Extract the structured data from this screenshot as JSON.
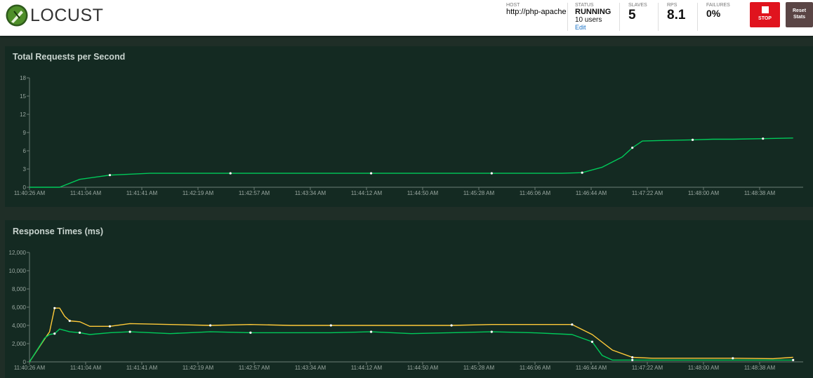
{
  "header": {
    "logo_text": "LOCUST",
    "host": {
      "label": "HOST",
      "value": "http://php-apache"
    },
    "status": {
      "label": "STATUS",
      "value": "RUNNING",
      "users": "10 users",
      "edit": "Edit"
    },
    "slaves": {
      "label": "SLAVES",
      "value": "5"
    },
    "rps": {
      "label": "RPS",
      "value": "8.1"
    },
    "failures": {
      "label": "FAILURES",
      "value": "0%"
    },
    "stop_label": "STOP",
    "reset_label_1": "Reset",
    "reset_label_2": "Stats"
  },
  "colors": {
    "green": "#00ca5a",
    "yellow": "#ffca39",
    "stop": "#e0141e"
  },
  "chart_data": [
    {
      "type": "line",
      "title": "Total Requests per Second",
      "xlabel": "",
      "ylabel": "",
      "ylim": [
        0,
        18
      ],
      "yticks": [
        "0",
        "3",
        "6",
        "9",
        "12",
        "15",
        "18"
      ],
      "xticks": [
        "11:40:26 AM",
        "11:41:04 AM",
        "11:41:41 AM",
        "11:42:19 AM",
        "11:42:57 AM",
        "11:43:34 AM",
        "11:44:12 AM",
        "11:44:50 AM",
        "11:45:28 AM",
        "11:46:06 AM",
        "11:46:44 AM",
        "11:47:22 AM",
        "11:48:00 AM",
        "11:48:38 AM"
      ],
      "grid": false,
      "series": [
        {
          "color": "#00ca5a",
          "x": [
            0,
            3,
            5,
            8,
            12,
            16,
            20,
            26,
            30,
            34,
            38,
            42,
            46,
            50,
            53,
            55,
            57,
            59,
            60,
            61,
            63,
            66,
            68,
            70,
            73,
            76
          ],
          "values": [
            0,
            0,
            1.3,
            2.0,
            2.3,
            2.3,
            2.3,
            2.3,
            2.3,
            2.3,
            2.3,
            2.3,
            2.3,
            2.3,
            2.3,
            2.4,
            3.3,
            5.0,
            6.5,
            7.6,
            7.7,
            7.8,
            7.9,
            7.9,
            8.0,
            8.1
          ]
        }
      ]
    },
    {
      "type": "line",
      "title": "Response Times (ms)",
      "xlabel": "",
      "ylabel": "",
      "ylim": [
        0,
        12000
      ],
      "yticks": [
        "0",
        "2,000",
        "4,000",
        "6,000",
        "8,000",
        "10,000",
        "12,000"
      ],
      "xticks": [
        "11:40:26 AM",
        "11:41:04 AM",
        "11:41:41 AM",
        "11:42:19 AM",
        "11:42:57 AM",
        "11:43:34 AM",
        "11:44:12 AM",
        "11:44:50 AM",
        "11:45:28 AM",
        "11:46:06 AM",
        "11:46:44 AM",
        "11:47:22 AM",
        "11:48:00 AM",
        "11:48:38 AM"
      ],
      "grid": false,
      "series": [
        {
          "color": "#ffca39",
          "x": [
            0,
            1.5,
            2,
            2.5,
            3,
            3.5,
            4,
            5,
            6,
            8,
            10,
            14,
            18,
            22,
            26,
            30,
            34,
            38,
            42,
            46,
            50,
            54,
            56,
            58,
            60,
            62,
            66,
            70,
            74,
            76
          ],
          "values": [
            0,
            2500,
            3300,
            5900,
            5900,
            5000,
            4500,
            4400,
            3900,
            3900,
            4200,
            4100,
            4000,
            4100,
            4000,
            4000,
            4000,
            4000,
            4000,
            4100,
            4100,
            4100,
            3000,
            1300,
            500,
            400,
            400,
            400,
            350,
            500
          ]
        },
        {
          "color": "#00ca5a",
          "x": [
            0,
            1.5,
            2,
            2.5,
            3,
            4,
            5,
            6,
            8,
            10,
            14,
            18,
            22,
            26,
            30,
            34,
            38,
            42,
            46,
            50,
            54,
            56,
            57,
            58,
            60,
            66,
            70,
            76
          ],
          "values": [
            0,
            2600,
            3000,
            3100,
            3600,
            3300,
            3200,
            3000,
            3200,
            3300,
            3100,
            3300,
            3200,
            3200,
            3200,
            3300,
            3100,
            3200,
            3300,
            3200,
            3000,
            2200,
            700,
            200,
            200,
            200,
            200,
            200
          ]
        }
      ]
    }
  ]
}
